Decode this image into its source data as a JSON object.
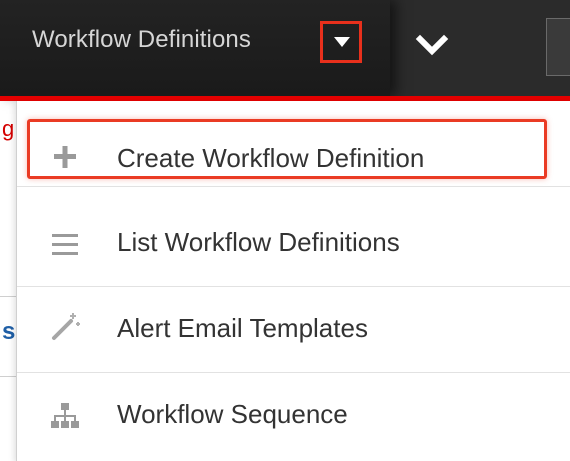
{
  "topnav": {
    "module_label": "Workflow Definitions",
    "caret_icon": "caret-down-icon",
    "more_icon": "chevron-down-icon"
  },
  "background_page": {
    "letter_top": "g",
    "letter_lower": "s"
  },
  "menu": {
    "items": [
      {
        "label": "Create Workflow Definition",
        "icon": "plus-icon",
        "highlighted": true
      },
      {
        "label": "List Workflow Definitions",
        "icon": "list-icon",
        "highlighted": false
      },
      {
        "label": "Alert Email Templates",
        "icon": "magic-wand-icon",
        "highlighted": false
      },
      {
        "label": "Workflow Sequence",
        "icon": "sitemap-icon",
        "highlighted": false
      }
    ]
  },
  "colors": {
    "topbar": "#2b2b2b",
    "accent_red": "#e40000",
    "highlight_border": "#ea3b24",
    "menu_text": "#333333",
    "icon_gray": "#9a9a9a"
  }
}
